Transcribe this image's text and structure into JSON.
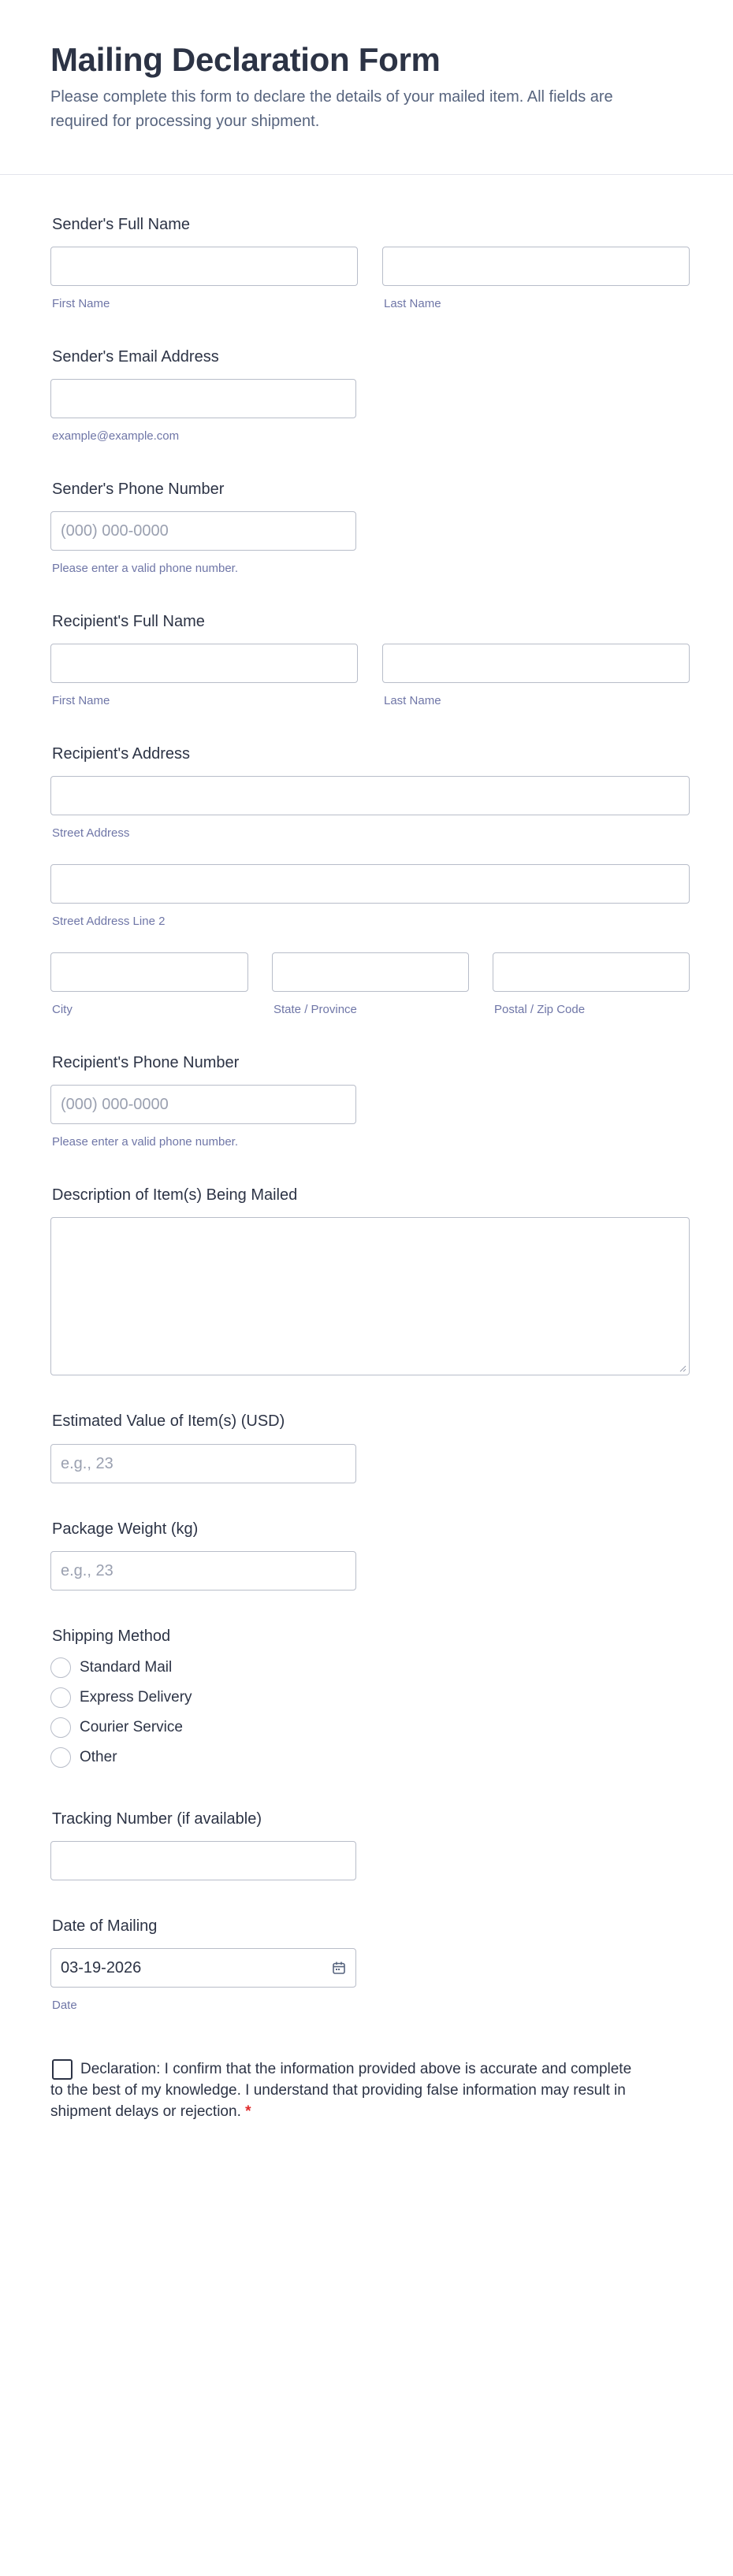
{
  "header": {
    "title": "Mailing Declaration Form",
    "description": "Please complete this form to declare the details of your mailed item. All fields are required for processing your shipment."
  },
  "sender_name": {
    "label": "Sender's Full Name",
    "first_sub": "First Name",
    "last_sub": "Last Name",
    "first_value": "",
    "last_value": ""
  },
  "sender_email": {
    "label": "Sender's Email Address",
    "sub": "example@example.com",
    "value": ""
  },
  "sender_phone": {
    "label": "Sender's Phone Number",
    "placeholder": "(000) 000-0000",
    "sub": "Please enter a valid phone number."
  },
  "recipient_name": {
    "label": "Recipient's Full Name",
    "first_sub": "First Name",
    "last_sub": "Last Name"
  },
  "recipient_address": {
    "label": "Recipient's Address",
    "street_sub": "Street Address",
    "street2_sub": "Street Address Line 2",
    "city_sub": "City",
    "state_sub": "State / Province",
    "zip_sub": "Postal / Zip Code"
  },
  "recipient_phone": {
    "label": "Recipient's Phone Number",
    "placeholder": "(000) 000-0000",
    "sub": "Please enter a valid phone number."
  },
  "description": {
    "label": "Description of Item(s) Being Mailed"
  },
  "value": {
    "label": "Estimated Value of Item(s) (USD)",
    "placeholder": "e.g., 23"
  },
  "weight": {
    "label": "Package Weight (kg)",
    "placeholder": "e.g., 23"
  },
  "shipping": {
    "label": "Shipping Method",
    "options": [
      "Standard Mail",
      "Express Delivery",
      "Courier Service",
      "Other"
    ]
  },
  "tracking": {
    "label": "Tracking Number (if available)"
  },
  "mailing_date": {
    "label": "Date of Mailing",
    "value": "03-19-2026",
    "sub": "Date",
    "icon": "calendar-icon"
  },
  "declaration": {
    "text": "Declaration: I confirm that the information provided above is accurate and complete to the best of my knowledge. I understand that providing false information may result in shipment delays or rejection.",
    "required_mark": "*",
    "checked": false
  },
  "colors": {
    "text": "#2c3345",
    "sub": "#6f76a7",
    "border": "#b8bdc9",
    "required": "#e02b2b"
  }
}
